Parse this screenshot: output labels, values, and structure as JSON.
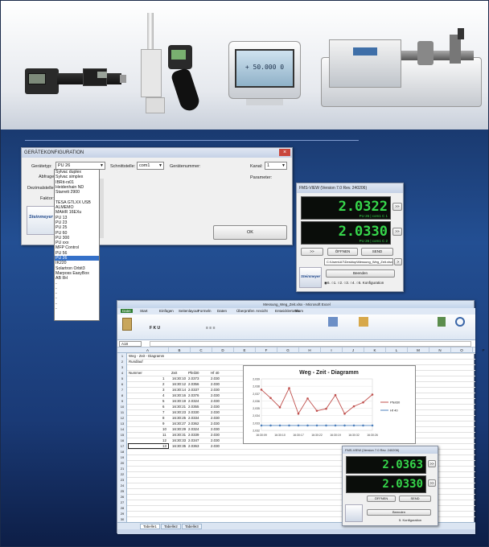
{
  "config_dialog": {
    "title": "GERÄTEKONFIGURATION",
    "geraetetyp_label": "Gerätetyp:",
    "geraetetyp_value": "PU 26",
    "schnittstelle_label": "Schnittstelle:",
    "schnittstelle_value": "com1",
    "geraetenummer_label": "Gerätenummer:",
    "kanal_label": "Kanal:",
    "kanal_value": "1",
    "parameter_label": "Parameter:",
    "abfrage_label": "Abfrage:",
    "dezimalstellen_label": "Dezimalstellen:",
    "faktor_label": "Faktor:",
    "ok_label": "OK",
    "logo_text": "Steinmeyer",
    "options": [
      "Sylvac duplex",
      "Sylvac simplex",
      "IBRit-rs01",
      "Heidenhain ND",
      "Starrett 2900",
      "",
      "TESA GTLXX USB",
      "ALMEMO",
      "MAHR 16EXu",
      "PU 13",
      "PU 23",
      "PU 25",
      "PU 60",
      "PU 300",
      "PU xxx",
      "MFP Control",
      "PU 56",
      "PU 26",
      "IK220",
      "Solartron Orbit3",
      "Marposs EasyBox",
      "AB IIH",
      "-",
      "-",
      "-",
      "-",
      "-",
      "-"
    ],
    "selected_option": 17
  },
  "fmsview": {
    "title": "FMS-VIEW (Version 7.0 Rev. 240206)",
    "value1": "2.0322",
    "sub1": "PU 26 | com1 C 1",
    "value2": "2.0330",
    "sub2": "PU 26 | com1 C 2",
    "arrow_label": ">>",
    "btn_back": ">>",
    "btn_open": "ÖFFNEN",
    "btn_send": "SEND",
    "path": "C:\\Users\\A7\\Desktop\\Messung_Weg_Zeit.xlsx",
    "btn_exit": "Beenden",
    "radio_labels": [
      "6.",
      "1.",
      "2.",
      "3.",
      "4.",
      "5. Konfiguration"
    ],
    "logo_text": "Steinmeyer"
  },
  "excel": {
    "title": "Messung_Weg_Zeit.xlsx - Microsoft Excel",
    "tabs": [
      "Datei",
      "Start",
      "Einfügen",
      "Seitenlayout",
      "Formeln",
      "Daten",
      "Überprüfen",
      "Ansicht",
      "Entwicklertools",
      "Team"
    ],
    "namebox": "A18",
    "sheet_title": "Weg - Zeit - Diagramm",
    "sheet_subtitle": "Rundlauf",
    "col_headers": [
      "Nummer",
      "Zeit",
      "Pfeil30",
      "Hf 40"
    ],
    "columns": [
      "A",
      "B",
      "C",
      "D",
      "E",
      "F",
      "G",
      "H",
      "I",
      "J",
      "K",
      "L",
      "M",
      "N",
      "O",
      "P"
    ],
    "rows": [
      [
        "1",
        "16:30:10",
        "2.0373",
        "2.030"
      ],
      [
        "2",
        "16:30:12",
        "2.0356",
        "2.030"
      ],
      [
        "3",
        "16:30:14",
        "2.0337",
        "2.030"
      ],
      [
        "4",
        "16:30:16",
        "2.0376",
        "2.030"
      ],
      [
        "5",
        "16:30:19",
        "2.0324",
        "2.030"
      ],
      [
        "6",
        "16:30:21",
        "2.0355",
        "2.030"
      ],
      [
        "7",
        "16:30:23",
        "2.0330",
        "2.030"
      ],
      [
        "8",
        "16:30:25",
        "2.0334",
        "2.030"
      ],
      [
        "9",
        "16:30:27",
        "2.0362",
        "2.030"
      ],
      [
        "10",
        "16:30:29",
        "2.0324",
        "2.030"
      ],
      [
        "11",
        "16:30:31",
        "2.0339",
        "2.030"
      ],
      [
        "12",
        "16:30:33",
        "2.0347",
        "2.030"
      ],
      [
        "13",
        "16:30:35",
        "2.0363",
        "2.030"
      ]
    ],
    "sheet_tabs": [
      "Tabelle1",
      "Tabelle2",
      "Tabelle3"
    ]
  },
  "chart_data": {
    "type": "line",
    "title": "Weg - Zeit - Diagramm",
    "x": [
      "16:30:09",
      "16:30:10",
      "16:30:17",
      "16:30:22",
      "16:30:19",
      "16:30:32",
      "16:30:26"
    ],
    "series": [
      {
        "name": "Pfeil30",
        "values": [
          2.0373,
          2.0356,
          2.0337,
          2.0376,
          2.0324,
          2.0355,
          2.033,
          2.0334,
          2.0362,
          2.0324,
          2.0339,
          2.0347,
          2.0363
        ],
        "color": "#c0504d"
      },
      {
        "name": "Hf 40",
        "values": [
          2.03,
          2.03,
          2.03,
          2.03,
          2.03,
          2.03,
          2.03,
          2.03,
          2.03,
          2.03,
          2.03,
          2.03,
          2.03
        ],
        "color": "#4f81bd"
      }
    ],
    "yticks": [
      "2,039",
      "2,038",
      "2,037",
      "2,036",
      "2,035",
      "2,034",
      "2,033",
      "2,032"
    ],
    "ylim": [
      2.029,
      2.0395
    ]
  },
  "fmsview_small": {
    "title": "FMS-VIEW (Version 7.0 Rev. 240206)",
    "value1": "2.0363",
    "value2": "2.0330",
    "btn_open": "ÖFFNEN",
    "btn_send": "SEND",
    "btn_exit": "Beenden",
    "config": "5. Konfiguration"
  },
  "photo": {
    "display_value": "+ 50.000 0"
  }
}
